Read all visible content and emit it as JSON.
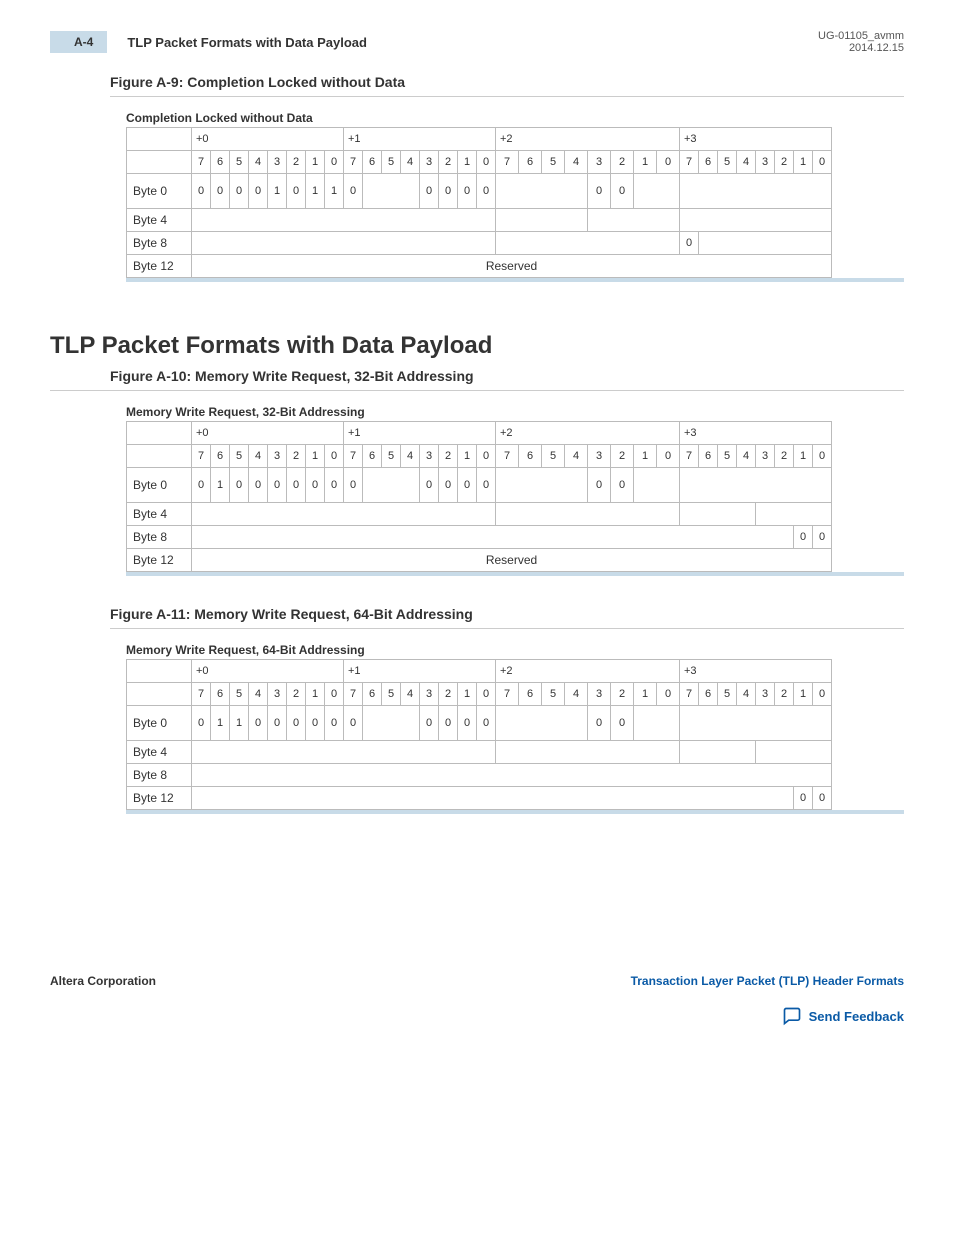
{
  "header": {
    "page_tag": "A-4",
    "title": "TLP Packet Formats with Data Payload",
    "doc_id": "UG-01105_avmm",
    "date": "2014.12.15"
  },
  "fig9": {
    "title": "Figure A-9: Completion Locked without Data",
    "caption": "Completion Locked without Data",
    "byte_headers": [
      "+0",
      "+1",
      "+2",
      "+3"
    ],
    "bit_labels": [
      "7",
      "6",
      "5",
      "4",
      "3",
      "2",
      "1",
      "0",
      "7",
      "6",
      "5",
      "4",
      "3",
      "2",
      "1",
      "0",
      "7",
      "6",
      "5",
      "4",
      "3",
      "2",
      "1",
      "0",
      "7",
      "6",
      "5",
      "4",
      "3",
      "2",
      "1",
      "0"
    ],
    "byte0": [
      "0",
      "0",
      "0",
      "0",
      "1",
      "0",
      "1",
      "1",
      "0",
      "",
      "",
      "",
      "0",
      "0",
      "0",
      "0",
      "",
      "",
      "",
      "",
      "0",
      "0",
      "",
      "",
      "",
      "",
      "",
      "",
      "",
      "",
      "",
      ""
    ],
    "rows": [
      "Byte 0",
      "Byte 4",
      "Byte 8",
      "Byte 12"
    ],
    "byte8_plus3_bit7": "0",
    "reserved": "Reserved"
  },
  "section_title": "TLP Packet Formats with Data Payload",
  "fig10": {
    "title": "Figure A-10: Memory Write Request, 32-Bit Addressing",
    "caption": "Memory Write Request, 32-Bit Addressing",
    "byte_headers": [
      "+0",
      "+1",
      "+2",
      "+3"
    ],
    "bit_labels": [
      "7",
      "6",
      "5",
      "4",
      "3",
      "2",
      "1",
      "0",
      "7",
      "6",
      "5",
      "4",
      "3",
      "2",
      "1",
      "0",
      "7",
      "6",
      "5",
      "4",
      "3",
      "2",
      "1",
      "0",
      "7",
      "6",
      "5",
      "4",
      "3",
      "2",
      "1",
      "0"
    ],
    "byte0": [
      "0",
      "1",
      "0",
      "0",
      "0",
      "0",
      "0",
      "0",
      "0",
      "",
      "",
      "",
      "0",
      "0",
      "0",
      "0",
      "",
      "",
      "",
      "",
      "0",
      "0",
      "",
      "",
      "",
      "",
      "",
      "",
      "",
      "",
      "",
      ""
    ],
    "rows": [
      "Byte 0",
      "Byte 4",
      "Byte 8",
      "Byte 12"
    ],
    "byte8_tail": [
      "0",
      "0"
    ],
    "reserved": "Reserved"
  },
  "fig11": {
    "title": "Figure A-11: Memory Write Request, 64-Bit Addressing",
    "caption": "Memory Write Request, 64-Bit Addressing",
    "byte_headers": [
      "+0",
      "+1",
      "+2",
      "+3"
    ],
    "bit_labels": [
      "7",
      "6",
      "5",
      "4",
      "3",
      "2",
      "1",
      "0",
      "7",
      "6",
      "5",
      "4",
      "3",
      "2",
      "1",
      "0",
      "7",
      "6",
      "5",
      "4",
      "3",
      "2",
      "1",
      "0",
      "7",
      "6",
      "5",
      "4",
      "3",
      "2",
      "1",
      "0"
    ],
    "byte0": [
      "0",
      "1",
      "1",
      "0",
      "0",
      "0",
      "0",
      "0",
      "0",
      "",
      "",
      "",
      "0",
      "0",
      "0",
      "0",
      "",
      "",
      "",
      "",
      "0",
      "0",
      "",
      "",
      "",
      "",
      "",
      "",
      "",
      "",
      "",
      ""
    ],
    "rows": [
      "Byte 0",
      "Byte 4",
      "Byte 8",
      "Byte 12"
    ],
    "byte12_tail": [
      "0",
      "0"
    ]
  },
  "footer": {
    "left": "Altera Corporation",
    "right": "Transaction Layer Packet (TLP) Header Formats",
    "feedback": "Send Feedback"
  }
}
